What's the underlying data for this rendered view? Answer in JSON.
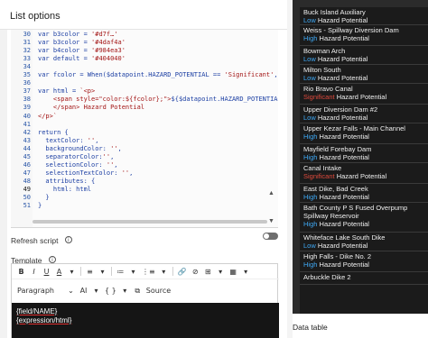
{
  "panel": {
    "title": "List options"
  },
  "editor": {
    "lines": [
      {
        "n": "30",
        "html": "<span class=\"k\">var</span> b3color = <span class=\"s\">'#d7f…'</span>"
      },
      {
        "n": "31",
        "html": "<span class=\"k\">var</span> b3color = <span class=\"s\">'#4daf4a'</span>"
      },
      {
        "n": "32",
        "html": "<span class=\"k\">var</span> b4color = <span class=\"s\">'#984ea3'</span>"
      },
      {
        "n": "33",
        "html": "<span class=\"k\">var</span> default = <span class=\"s\">'#404040'</span>"
      },
      {
        "n": "34",
        "html": ""
      },
      {
        "n": "35",
        "html": "<span class=\"k\">var</span> fcolor = When($datapoint.HAZARD_POTENTIAL == <span class=\"s\">'Significant'</span>, b"
      },
      {
        "n": "36",
        "html": ""
      },
      {
        "n": "37",
        "html": "<span class=\"k\">var</span> html = <span class=\"s\">`&lt;p&gt;</span>"
      },
      {
        "n": "38",
        "html": "    <span class=\"s\">&lt;span style=\"color:${fcolor};\"&gt;</span>${$datapoint.HAZARD_POTENTIAL}"
      },
      {
        "n": "39",
        "html": "    <span class=\"s\">&lt;/span&gt; Hazard Potential</span>"
      },
      {
        "n": "40",
        "html": "<span class=\"s\">&lt;/p&gt;`</span>"
      },
      {
        "n": "41",
        "html": ""
      },
      {
        "n": "42",
        "html": "<span class=\"k\">return</span> {"
      },
      {
        "n": "43",
        "html": "  textColor: <span class=\"s\">''</span>,"
      },
      {
        "n": "44",
        "html": "  backgroundColor: <span class=\"s\">''</span>,"
      },
      {
        "n": "45",
        "html": "  separatorColor:<span class=\"s\">''</span>,"
      },
      {
        "n": "46",
        "html": "  selectionColor: <span class=\"s\">''</span>,"
      },
      {
        "n": "47",
        "html": "  selectionTextColor: <span class=\"s\">''</span>,"
      },
      {
        "n": "48",
        "html": "  attributes: {"
      },
      {
        "n": "49",
        "html": "    html: html"
      },
      {
        "n": "50",
        "html": "  }"
      },
      {
        "n": "51",
        "html": "}"
      }
    ]
  },
  "refresh": {
    "label": "Refresh script"
  },
  "template": {
    "label": "Template",
    "toolbar1": [
      "B",
      "I",
      "U",
      "A",
      "▾",
      "≡",
      "▾",
      "≔",
      "▾",
      "⋮≡",
      "▾",
      "🔗",
      "⊘",
      "⊞",
      "▾",
      "▦",
      "▾"
    ],
    "paragraph": "Paragraph",
    "font_size_label": "AI",
    "source_label": "Source",
    "content_line1": "{field/NAME}",
    "content_line2": "{expression/html}"
  },
  "list": {
    "items": [
      {
        "name": "Buck Island Auxiliary",
        "level": "Low",
        "suffix": " Hazard Potential"
      },
      {
        "name": "Weiss - Spillway Diversion Dam",
        "level": "High",
        "suffix": " Hazard Potential"
      },
      {
        "name": "Bowman Arch",
        "level": "Low",
        "suffix": " Hazard Potential"
      },
      {
        "name": "Milton South",
        "level": "Low",
        "suffix": " Hazard Potential"
      },
      {
        "name": "Rio Bravo Canal",
        "level": "Significant",
        "suffix": " Hazard Potential"
      },
      {
        "name": "Upper Diversion Dam #2",
        "level": "Low",
        "suffix": " Hazard Potential"
      },
      {
        "name": "Upper Kezar Falls - Main Channel",
        "level": "High",
        "suffix": " Hazard Potential"
      },
      {
        "name": "Mayfield Forebay Dam",
        "level": "High",
        "suffix": " Hazard Potential"
      },
      {
        "name": "Canal Intake",
        "level": "Significant",
        "suffix": " Hazard Potential"
      },
      {
        "name": "East Dike, Bad Creek",
        "level": "High",
        "suffix": " Hazard Potential"
      },
      {
        "name": "Bath County P S Fused Overpump Spillway Reservoir",
        "level": "High",
        "suffix": " Hazard Potential"
      },
      {
        "name": "Whiteface Lake South Dike",
        "level": "Low",
        "suffix": " Hazard Potential"
      },
      {
        "name": "High Falls - Dike No. 2",
        "level": "High",
        "suffix": " Hazard Potential"
      },
      {
        "name": "Arbuckle Dike 2",
        "level": "",
        "suffix": ""
      }
    ]
  },
  "data_table": {
    "label": "Data table"
  }
}
